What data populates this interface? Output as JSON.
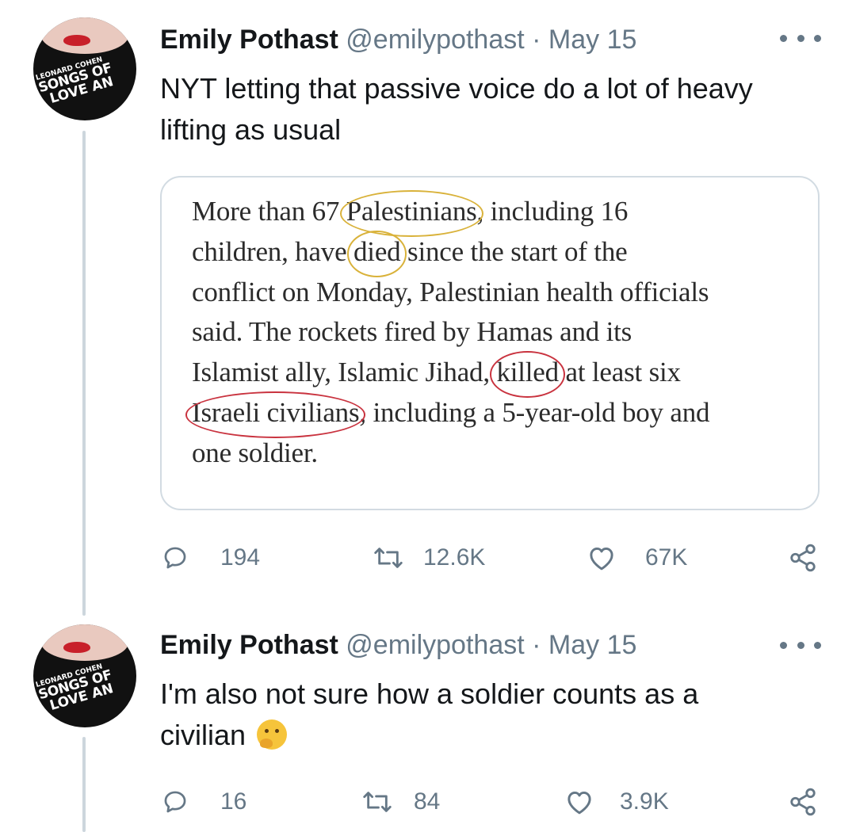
{
  "tweets": [
    {
      "name": "Emily Pothast",
      "handle": "@emilypothast",
      "separator": "·",
      "date": "May 15",
      "text": "NYT letting that passive voice do a lot of heavy lifting as usual",
      "quote_image": {
        "line1": [
          "More than 67 ",
          "Palestinians",
          ", including 16"
        ],
        "line2": [
          "children, have ",
          "died",
          " since the start of the"
        ],
        "line3": "conflict on Monday, Palestinian health officials",
        "line4": "said. The rockets fired by Hamas and its",
        "line5": [
          "Islamist ally, Islamic Jihad, ",
          "killed",
          " at least six"
        ],
        "line6": [
          "Israeli civilians",
          ", including a 5-year-old boy and"
        ],
        "line7": "one soldier."
      },
      "replies": "194",
      "retweets": "12.6K",
      "likes": "67K"
    },
    {
      "name": "Emily Pothast",
      "handle": "@emilypothast",
      "separator": "·",
      "date": "May 15",
      "text": "I'm also not sure how a soldier counts as a civilian",
      "emoji_name": "thinking-face-emoji",
      "replies": "16",
      "retweets": "84",
      "likes": "3.9K"
    }
  ],
  "avatar_shirt_text": [
    "LEONARD COHEN",
    "SONGS OF",
    "LOVE AN"
  ],
  "colors": {
    "text": "#14171a",
    "secondary": "#657786",
    "thread_line": "#cdd6dd",
    "card_border": "#d2dbe2",
    "gold_circle": "#d9b23a",
    "red_circle": "#c9333f"
  }
}
